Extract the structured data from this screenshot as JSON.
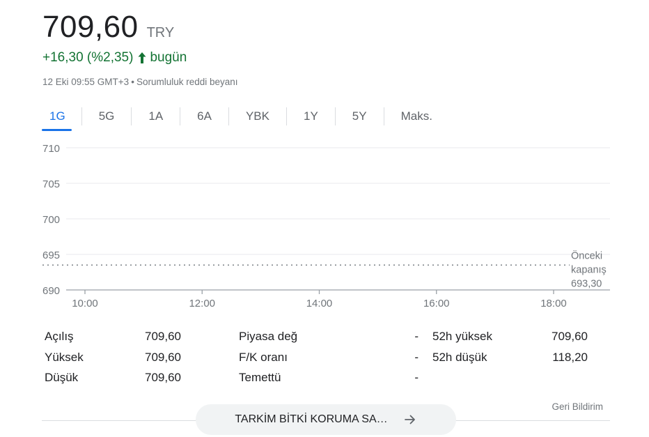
{
  "quote": {
    "price": "709,60",
    "currency": "TRY",
    "change": "+16,30 (%2,35)",
    "change_period": "bugün",
    "timestamp": "12 Eki 09:55 GMT+3",
    "disclaimer": "Sorumluluk reddi beyanı"
  },
  "tabs": [
    "1G",
    "5G",
    "1A",
    "6A",
    "YBK",
    "1Y",
    "5Y",
    "Maks."
  ],
  "active_tab": "1G",
  "chart_data": {
    "type": "line",
    "x_ticks": [
      "10:00",
      "12:00",
      "14:00",
      "16:00",
      "18:00"
    ],
    "y_ticks": [
      690,
      695,
      700,
      705,
      710
    ],
    "ylim": [
      690,
      710
    ],
    "grid": true,
    "reference_line": {
      "label_line1": "Önceki",
      "label_line2": "kapanış",
      "value": 693.3,
      "value_label": "693,30"
    },
    "series": [],
    "colors": {
      "grid": "#e8eaed",
      "axis": "#9aa0a6",
      "reference": "#80868b",
      "text": "#70757a"
    }
  },
  "stats": {
    "col1": [
      {
        "label": "Açılış",
        "value": "709,60"
      },
      {
        "label": "Yüksek",
        "value": "709,60"
      },
      {
        "label": "Düşük",
        "value": "709,60"
      }
    ],
    "col2": [
      {
        "label": "Piyasa değ",
        "value": "-"
      },
      {
        "label": "F/K oranı",
        "value": "-"
      },
      {
        "label": "Temettü",
        "value": "-"
      }
    ],
    "col3": [
      {
        "label": "52h yüksek",
        "value": "709,60"
      },
      {
        "label": "52h düşük",
        "value": "118,20"
      }
    ]
  },
  "footer": {
    "feedback": "Geri Bildirim",
    "more_button": "TARKİM BİTKİ KORUMA SA…"
  },
  "colors": {
    "positive": "#137333",
    "accent": "#1a73e8"
  }
}
